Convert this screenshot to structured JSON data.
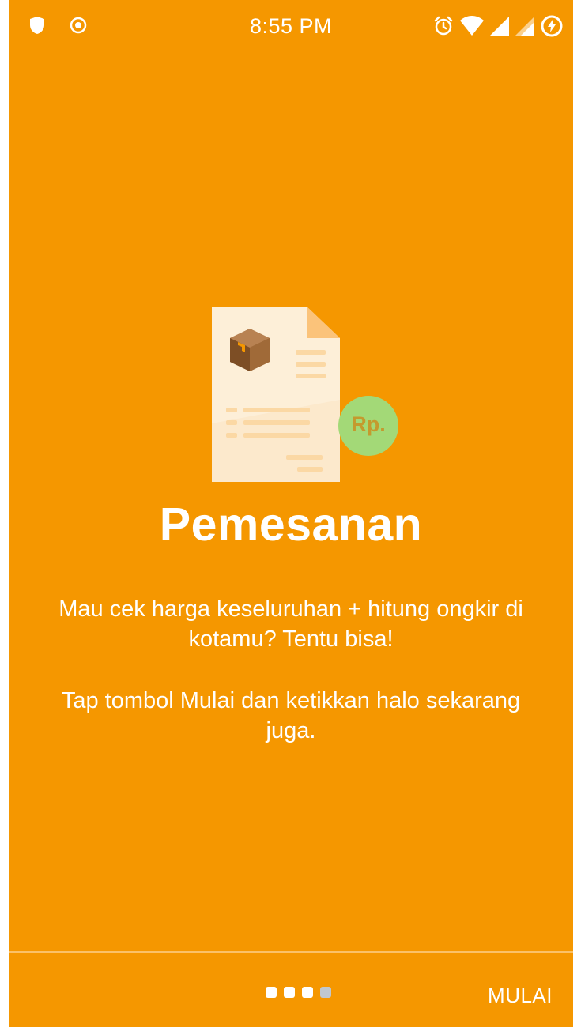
{
  "status_bar": {
    "time": "8:55 PM",
    "left_icons": [
      "shield-icon",
      "record-icon"
    ],
    "right_icons": [
      "alarm-icon",
      "wifi-icon",
      "signal-icon",
      "signal-icon-2",
      "battery-charging-icon"
    ]
  },
  "illustration": {
    "icon": "order-document-icon",
    "badge_text": "Rp."
  },
  "onboarding": {
    "title": "Pemesanan",
    "description_1": "Mau cek harga keseluruhan + hitung ongkir di kotamu? Tentu bisa!",
    "description_2": "Tap tombol Mulai dan ketikkan halo sekarang juga."
  },
  "pager": {
    "total": 4,
    "active_index": 3
  },
  "footer": {
    "start_label": "MULAI"
  },
  "colors": {
    "background": "#f59700",
    "paper": "#fdefd8",
    "badge": "#a3d977",
    "text": "#ffffff"
  }
}
